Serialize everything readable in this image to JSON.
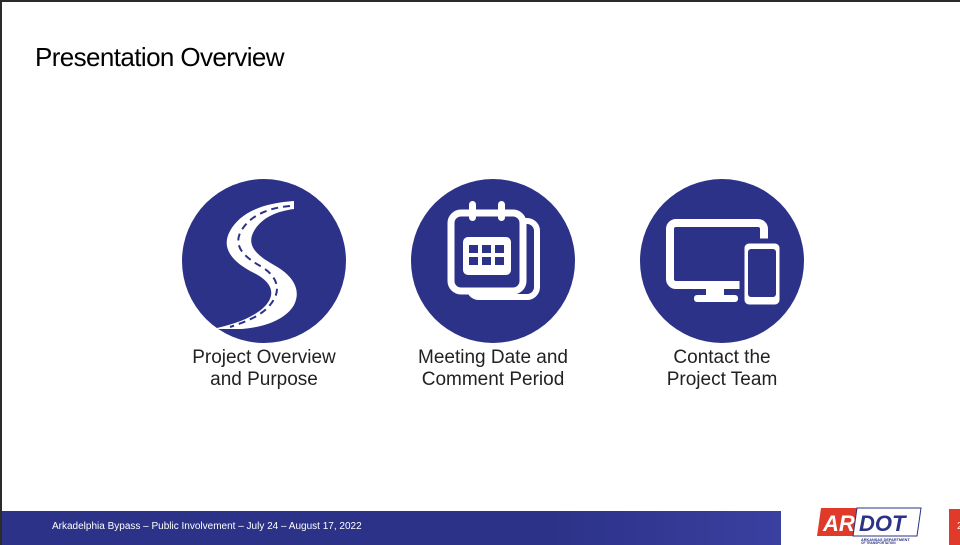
{
  "slide": {
    "title": "Presentation Overview",
    "items": [
      {
        "icon": "road-icon",
        "line1": "Project Overview",
        "line2": "and Purpose"
      },
      {
        "icon": "calendar-icon",
        "line1": "Meeting Date and",
        "line2": "Comment Period"
      },
      {
        "icon": "devices-icon",
        "line1": "Contact the",
        "line2": "Project Team"
      }
    ]
  },
  "footer": {
    "text": "Arkadelphia Bypass – Public Involvement – July 24 – August 17, 2022",
    "logo_text": "ARDOT",
    "logo_subtext": "ARKANSAS DEPARTMENT OF TRANSPORTATION",
    "page_number": "2"
  },
  "colors": {
    "circle": "#2b3287",
    "footer_bar": "#2b3287",
    "accent_red": "#e03a2a"
  }
}
